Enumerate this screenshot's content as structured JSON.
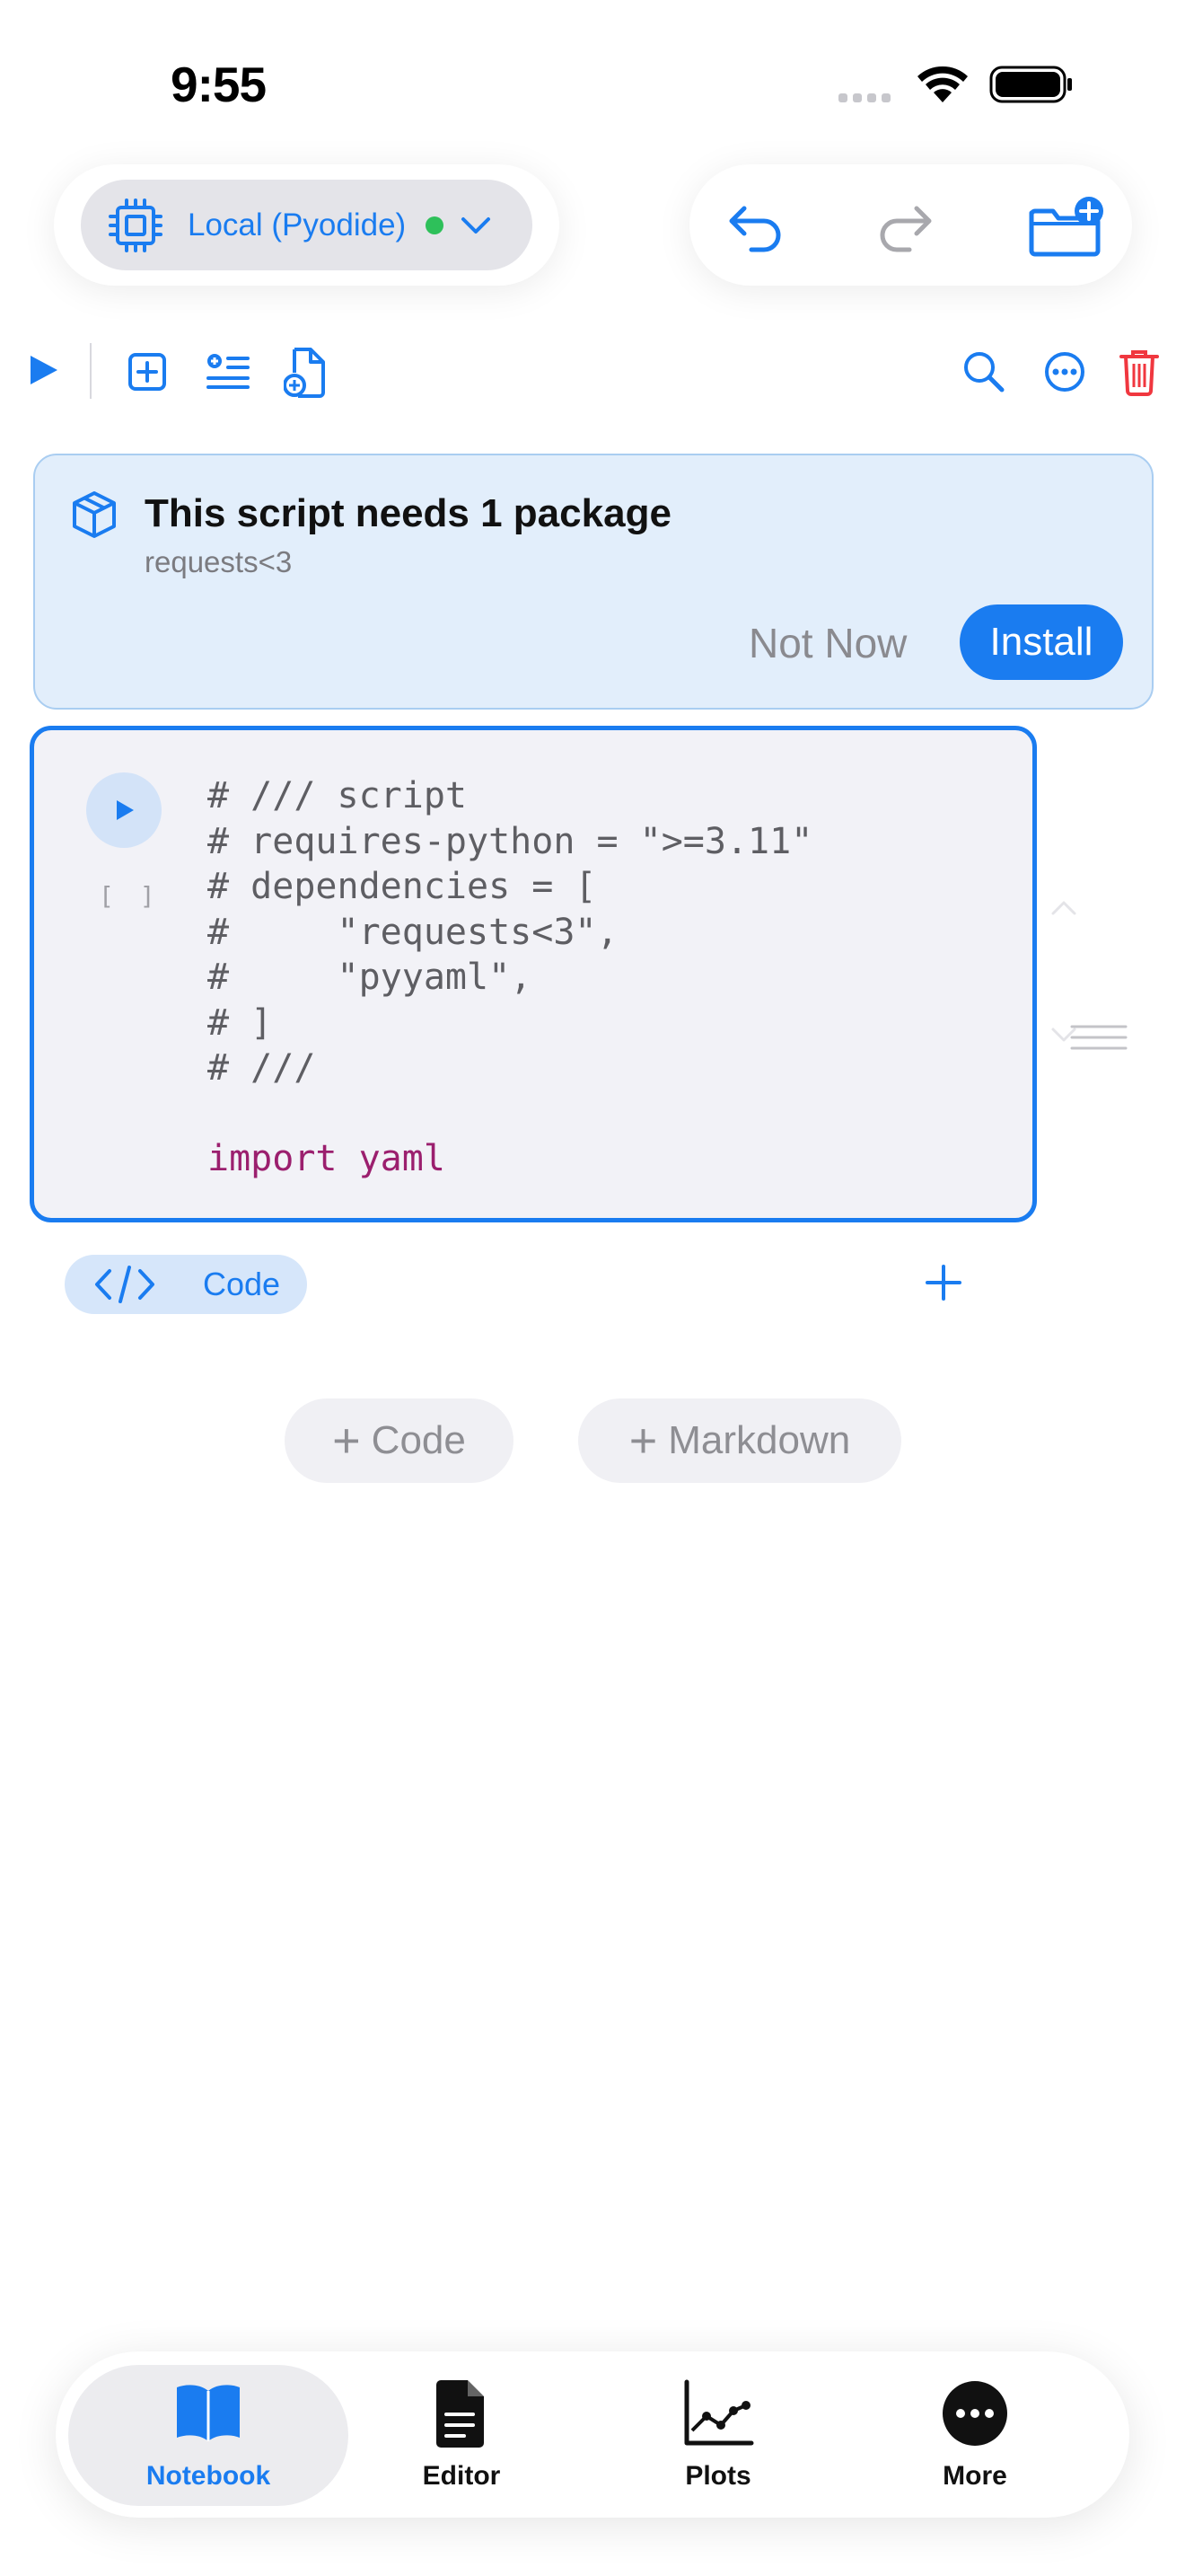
{
  "status_bar": {
    "time": "9:55"
  },
  "kernel": {
    "label": "Local (Pyodide)",
    "status_color": "#2ec05a"
  },
  "banner": {
    "title": "This script needs 1 package",
    "subtitle": "requests<3",
    "not_now_label": "Not Now",
    "install_label": "Install"
  },
  "cell": {
    "execution_count": "[ ]",
    "code_lines": [
      "# /// script",
      "# requires-python = \">=3.11\"",
      "# dependencies = [",
      "#     \"requests<3\",",
      "#     \"pyyaml\",",
      "# ]",
      "# ///",
      "",
      "import yaml"
    ],
    "type_label": "Code"
  },
  "add_buttons": {
    "code_label": "Code",
    "markdown_label": "Markdown"
  },
  "tabs": [
    {
      "label": "Notebook",
      "icon": "book-icon",
      "active": true
    },
    {
      "label": "Editor",
      "icon": "document-icon",
      "active": false
    },
    {
      "label": "Plots",
      "icon": "chart-icon",
      "active": false
    },
    {
      "label": "More",
      "icon": "ellipsis-circle-icon",
      "active": false
    }
  ],
  "colors": {
    "accent": "#1a7cf0",
    "danger": "#f0373f",
    "success": "#2ec05a"
  }
}
